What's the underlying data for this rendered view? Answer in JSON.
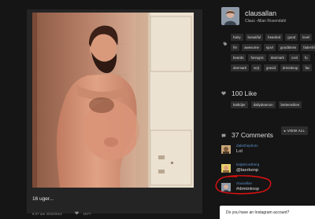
{
  "post": {
    "caption": "16 uger...",
    "time": "8:37 am 4/22/2013",
    "likes_short": "1977"
  },
  "profile": {
    "username": "clausallan",
    "full_name": "Claus -Allan Rosendahl"
  },
  "tags": [
    "hairy",
    "beautiful",
    "bearded",
    "good",
    "lovel",
    "fre",
    "awesome",
    "sjovt",
    "goodtimes",
    "fadershi",
    "beards",
    "funnypic",
    "danmark",
    "cool",
    "fu",
    "denmark",
    "sejt",
    "gravid",
    "drminkrop",
    "fac"
  ],
  "likes": {
    "label": "100 Like",
    "likers": [
      "kathdjer",
      "dailydeamon",
      "betteemiliee"
    ]
  },
  "comments": {
    "label": "37 Comments",
    "view_all": "▸ VIEW ALL",
    "items": [
      {
        "user": "dabirthephoto",
        "text": "Lol"
      },
      {
        "user": "katjakrossberg",
        "text": "@laerkenp"
      },
      {
        "user": "clausallan",
        "text": "#drminkrop"
      }
    ]
  },
  "popup": {
    "text": "Do you have an Instagram account?"
  },
  "colors": {
    "background": "#151515",
    "card": "#242424",
    "tag_bg": "#2d2d2d",
    "link": "#5a8ec4",
    "highlight": "#e01010"
  }
}
